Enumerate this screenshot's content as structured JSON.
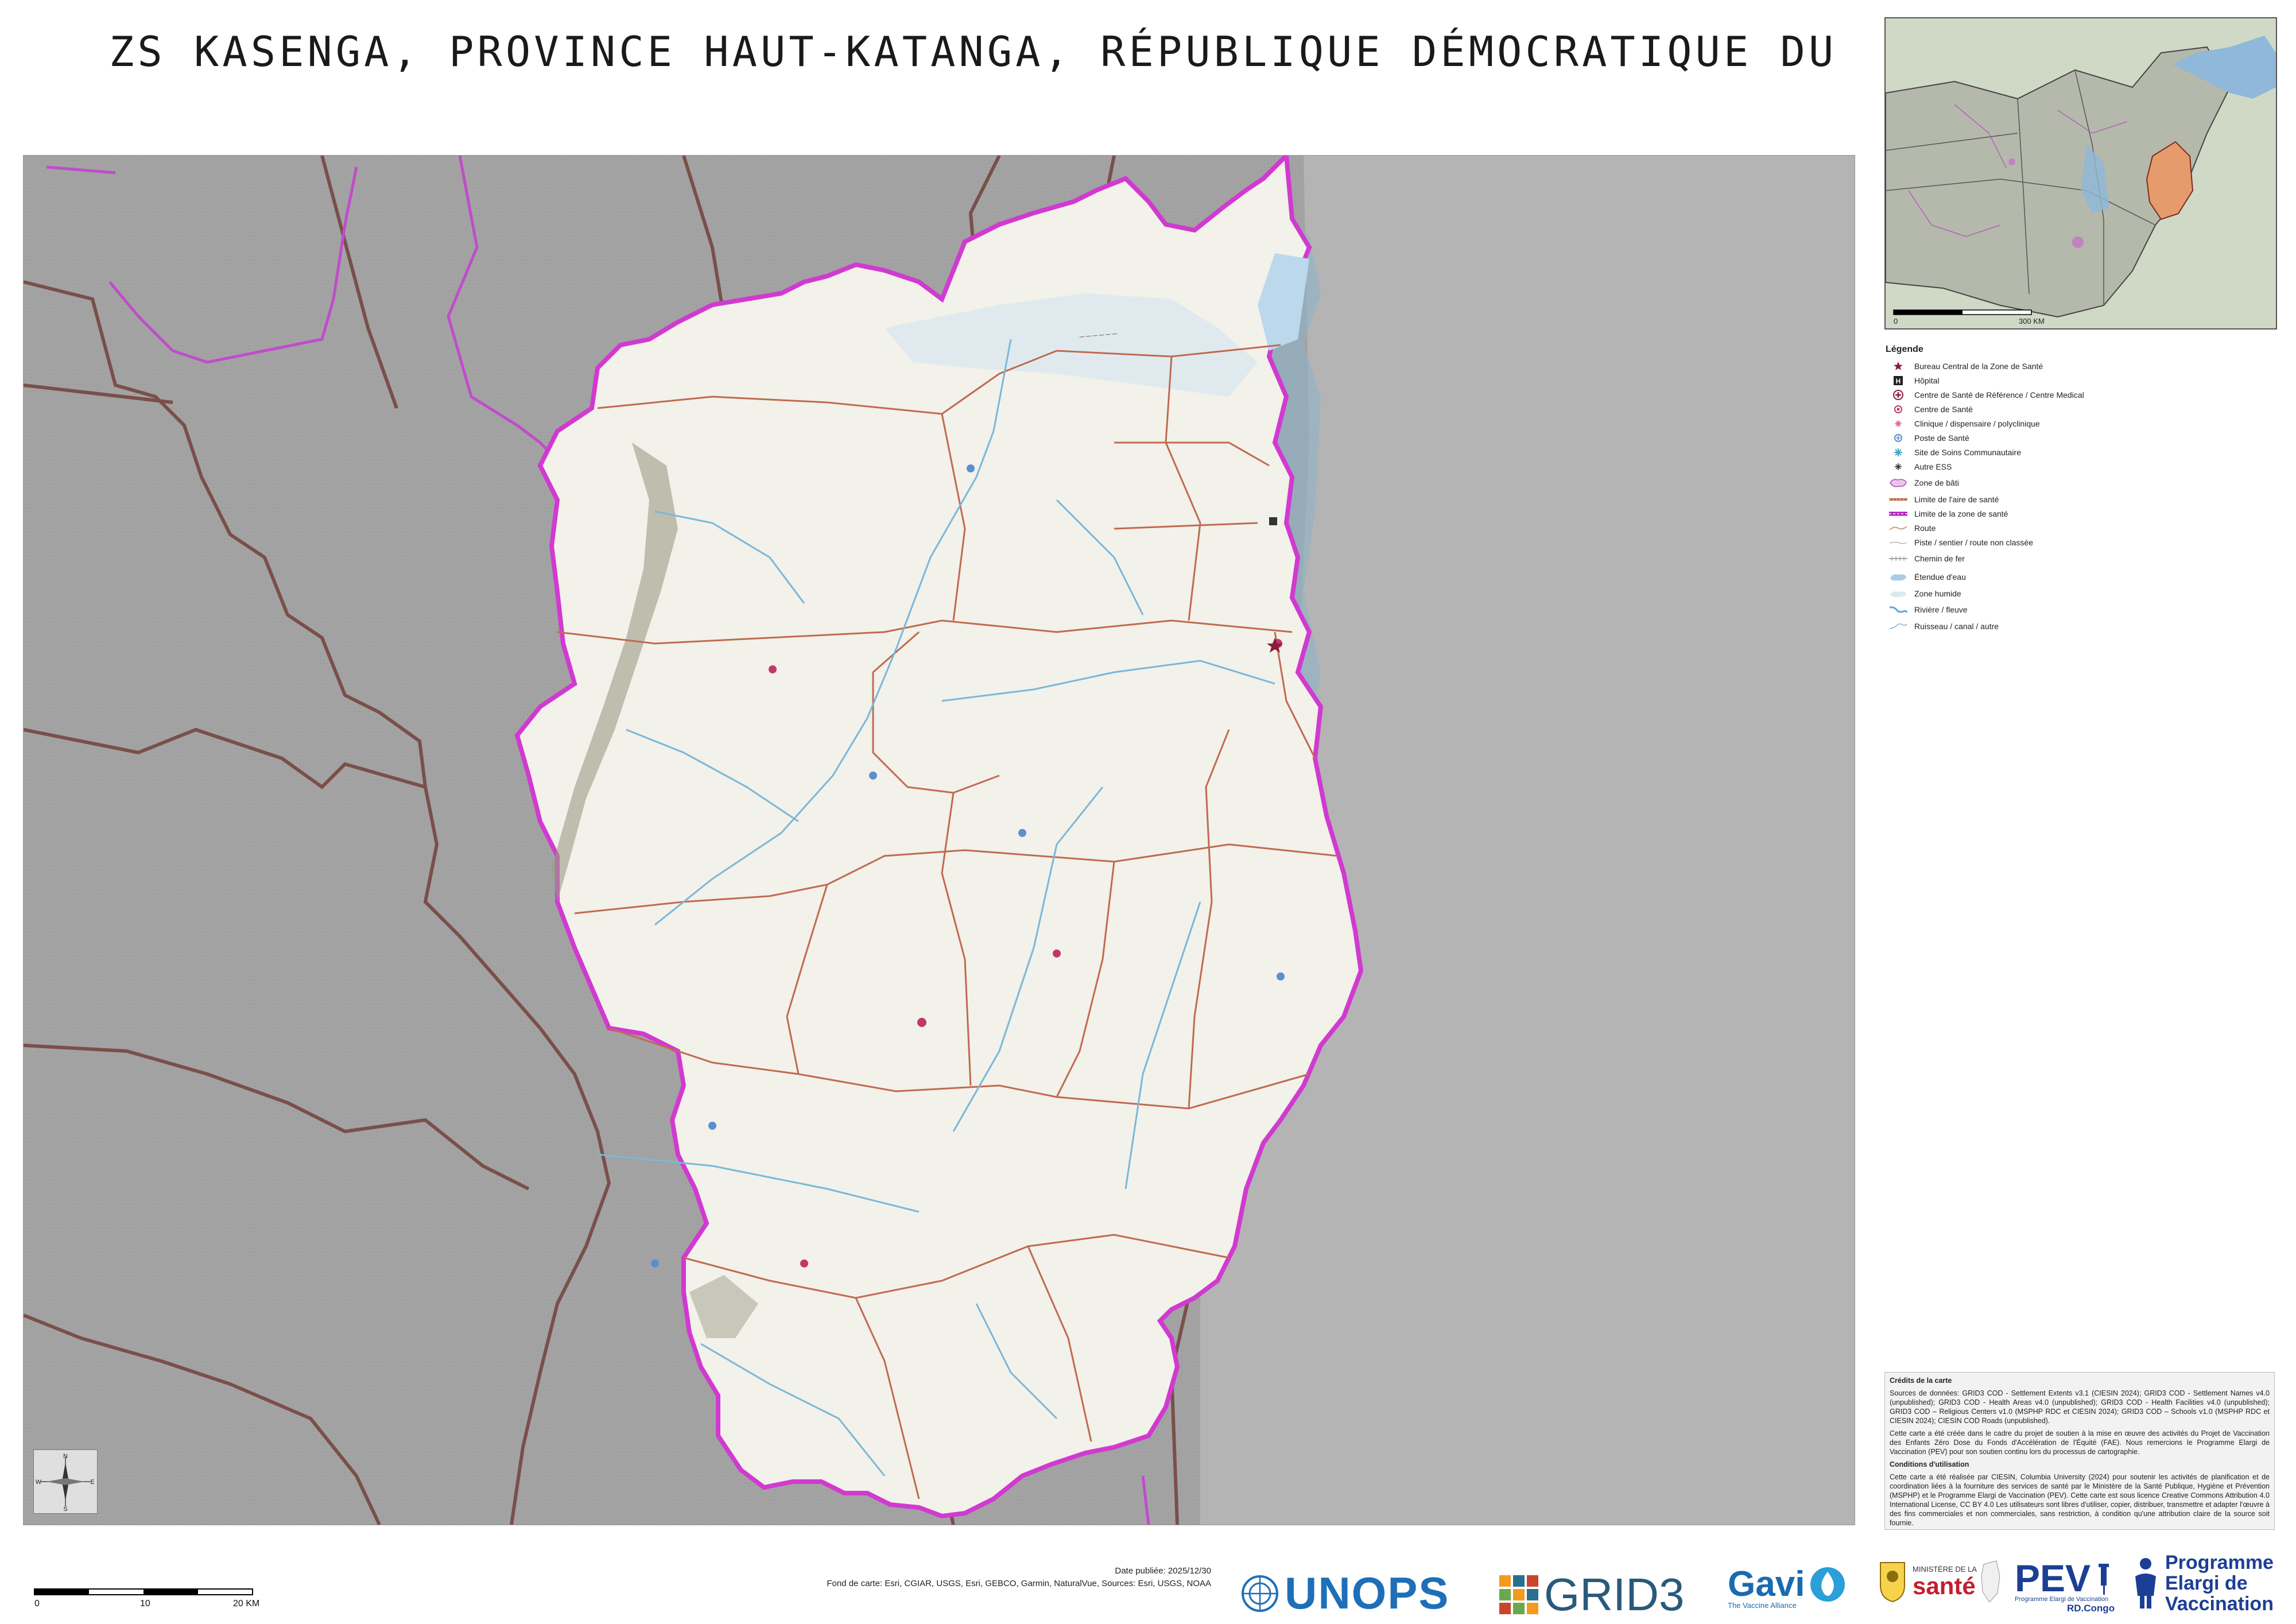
{
  "title": "ZS KASENGA, PROVINCE HAUT-KATANGA, RÉPUBLIQUE DÉMOCRATIQUE DU",
  "colors": {
    "zone_fill": "#f2f1ea",
    "zone_border": "#d13ad0",
    "outside": "#999999",
    "lake": "#a8cde8",
    "road": "#c06a50",
    "river": "#7bb7d9",
    "admin_border": "#7a4f4a",
    "inset_highlight": "#e59b6b"
  },
  "inset": {
    "scale_start": "0",
    "scale_end": "300 KM"
  },
  "legend": {
    "title": "Légende",
    "items": [
      {
        "icon": "star-icon",
        "label": "Bureau Central de la Zone de Santé"
      },
      {
        "icon": "hospital-icon",
        "label": "Hôpital"
      },
      {
        "icon": "reference-center-icon",
        "label": "Centre de Santé de Référence / Centre Medical"
      },
      {
        "icon": "health-center-icon",
        "label": "Centre de Santé"
      },
      {
        "icon": "clinic-icon",
        "label": "Clinique / dispensaire / polyclinique"
      },
      {
        "icon": "health-post-icon",
        "label": "Poste de Santé"
      },
      {
        "icon": "community-site-icon",
        "label": "Site de Soins Communautaire"
      },
      {
        "icon": "other-facility-icon",
        "label": "Autre ESS"
      },
      {
        "icon": "built-area-icon",
        "label": "Zone de bâti"
      },
      {
        "icon": "health-area-border-icon",
        "label": "Limite de l'aire de santé"
      },
      {
        "icon": "health-zone-border-icon",
        "label": "Limite de la zone de santé"
      },
      {
        "icon": "road-icon",
        "label": "Route"
      },
      {
        "icon": "track-icon",
        "label": "Piste / sentier / route non classée"
      },
      {
        "icon": "railway-icon",
        "label": "Chemin de fer"
      },
      {
        "icon": "water-body-icon",
        "label": "Étendue d'eau"
      },
      {
        "icon": "wetland-icon",
        "label": "Zone humide"
      },
      {
        "icon": "river-icon",
        "label": "Rivière / fleuve"
      },
      {
        "icon": "stream-icon",
        "label": "Ruisseau / canal / autre"
      }
    ]
  },
  "credits": {
    "heading": "Crédits de la carte",
    "sources": "Sources de données: GRID3 COD - Settlement Extents v3.1 (CIESIN 2024); GRID3 COD - Settlement Names v4.0 (unpublished); GRID3 COD - Health Areas v4.0 (unpublished); GRID3 COD - Health Facilities v4.0 (unpublished); GRID3 COD – Religious Centers v1.0 (MSPHP RDC et CIESIN 2024); GRID3 COD – Schools v1.0 (MSPHP RDC et CIESIN 2024); CIESIN COD Roads (unpublished).",
    "project": "Cette carte a été créée dans le cadre du projet de soutien à la mise en œuvre des activités du Projet de Vaccination des Enfants Zéro Dose du Fonds d'Accélération de l'Équité (FAE). Nous remercions le Programme Elargi de Vaccination (PEV) pour son soutien continu lors du processus de cartographie.",
    "conditions_heading": "Conditions d'utilisation",
    "conditions": "Cette carte a été réalisée par CIESIN, Columbia University (2024) pour soutenir les activités de planification et de coordination liées à la fourniture des services de santé par le Ministère de la Santé Publique, Hygiène et Prévention (MSPHP) et le Programme Elargi de Vaccination (PEV). Cette carte est sous licence Creative Commons Attribution 4.0 International License, CC BY 4.0 Les utilisateurs sont libres d'utiliser, copier, distribuer, transmettre et adapter l'œuvre à des fins commerciales et non commerciales, sans restriction, à condition qu'une attribution claire de la source soit fournie."
  },
  "scale": {
    "labels": [
      "0",
      "10",
      "20 KM"
    ]
  },
  "date": "Date publiée: 2025/12/30",
  "basemap": "Fond de carte: Esri, CGIAR, USGS, Esri, GEBCO, Garmin, NaturalVue, Sources: Esri, USGS, NOAA",
  "compass": {
    "n": "N",
    "s": "S",
    "e": "E",
    "w": "W"
  },
  "logos": {
    "unops": "UNOPS",
    "grid3": "GRID3",
    "gavi": "Gavi",
    "gavi_sub": "The Vaccine Alliance",
    "ministry_top": "MINISTÈRE DE LA",
    "ministry_main": "santé",
    "pev": "PEV",
    "pev_sub": "Programme Elargi de Vaccination",
    "pev_country": "RD.Congo",
    "programme_line1": "Programme",
    "programme_line2": "Elargi de",
    "programme_line3": "Vaccination"
  }
}
